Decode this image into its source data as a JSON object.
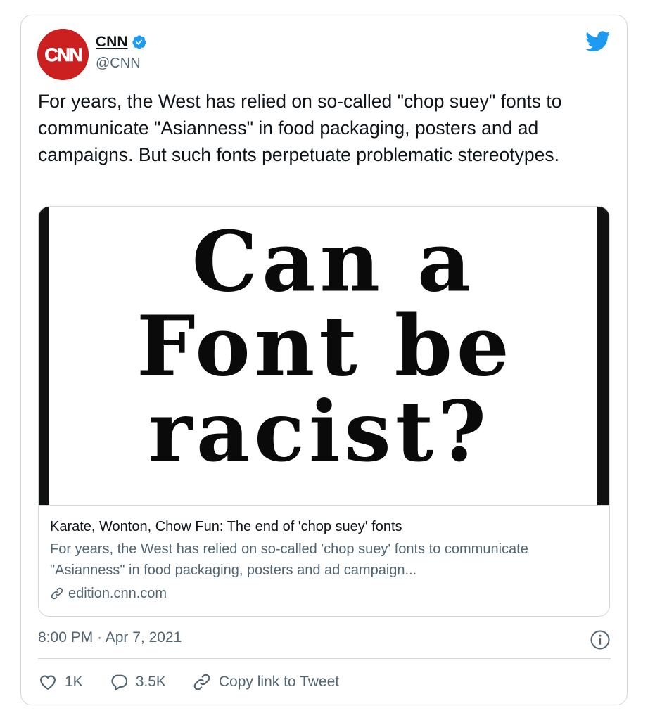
{
  "author": {
    "name": "CNN",
    "handle": "@CNN",
    "avatar_text": "CNN",
    "verified": true,
    "avatar_color": "#cc1f1f"
  },
  "tweet": {
    "text": "For years, the West has relied on so-called \"chop suey\" fonts to communicate \"Asianness\" in food packaging, posters and ad campaigns. But such fonts perpetuate problematic stereotypes."
  },
  "link_card": {
    "image_lines": [
      "Can a",
      "Font be",
      "racist?"
    ],
    "title": "Karate, Wonton, Chow Fun: The end of 'chop suey' fonts",
    "description": "For years, the West has relied on so-called 'chop suey' fonts to communicate \"Asianness\" in food packaging, posters and ad campaign...",
    "domain": "edition.cnn.com"
  },
  "timestamp": "8:00 PM · Apr 7, 2021",
  "actions": {
    "like_count": "1K",
    "reply_count": "3.5K",
    "copy_link_label": "Copy link to Tweet"
  },
  "colors": {
    "twitter_blue": "#1d9bf0",
    "secondary_text": "#536471",
    "border": "#cfd9de"
  },
  "icons": [
    "verified-badge-icon",
    "twitter-bird-icon",
    "link-icon",
    "info-icon",
    "heart-icon",
    "reply-bubble-icon",
    "copy-link-icon"
  ]
}
